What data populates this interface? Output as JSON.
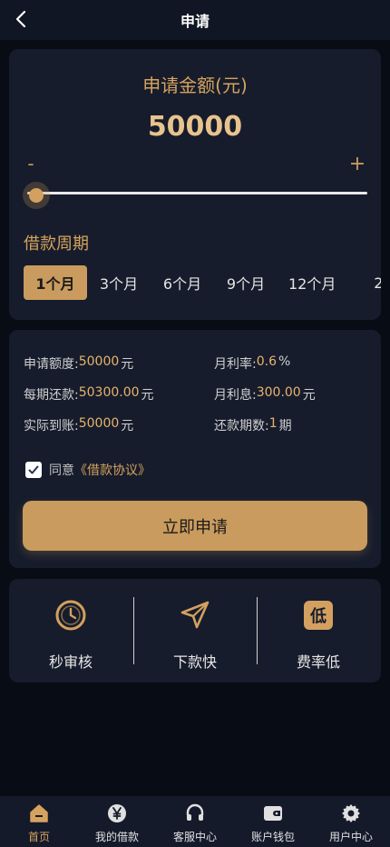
{
  "header": {
    "title": "申请"
  },
  "amount": {
    "title": "申请金额(元)",
    "value": "50000",
    "minus": "-",
    "plus": "+",
    "slider_level": 0
  },
  "period": {
    "title": "借款周期",
    "options": [
      "1个月",
      "3个月",
      "6个月",
      "9个月",
      "12个月",
      "2"
    ],
    "selected_index": 0
  },
  "info": {
    "apply_amount_label": "申请额度:",
    "apply_amount_value": "50000",
    "apply_amount_unit": "元",
    "monthly_rate_label": "月利率:",
    "monthly_rate_value": "0.6",
    "monthly_rate_unit": "%",
    "per_period_label": "每期还款:",
    "per_period_value": "50300.00",
    "per_period_unit": "元",
    "monthly_interest_label": "月利息:",
    "monthly_interest_value": "300.00",
    "monthly_interest_unit": "元",
    "actual_label": "实际到账:",
    "actual_value": "50000",
    "actual_unit": "元",
    "periods_label": "还款期数:",
    "periods_value": "1",
    "periods_unit": "期"
  },
  "agreement": {
    "checked": true,
    "text": "同意",
    "link": "《借款协议》"
  },
  "apply_button": "立即申请",
  "features": [
    {
      "label": "秒审核",
      "icon": "clock-icon"
    },
    {
      "label": "下款快",
      "icon": "send-icon"
    },
    {
      "label": "费率低",
      "icon": "low-rate-icon",
      "glyph": "低"
    }
  ],
  "nav": [
    {
      "label": "首页",
      "icon": "home-icon",
      "active": true
    },
    {
      "label": "我的借款",
      "icon": "yen-icon"
    },
    {
      "label": "客服中心",
      "icon": "headset-icon"
    },
    {
      "label": "账户钱包",
      "icon": "wallet-icon"
    },
    {
      "label": "用户中心",
      "icon": "gear-icon"
    }
  ],
  "colors": {
    "accent": "#c99b5e",
    "accent_text": "#d6a35e",
    "card": "#161c2b",
    "background": "#080c14"
  }
}
